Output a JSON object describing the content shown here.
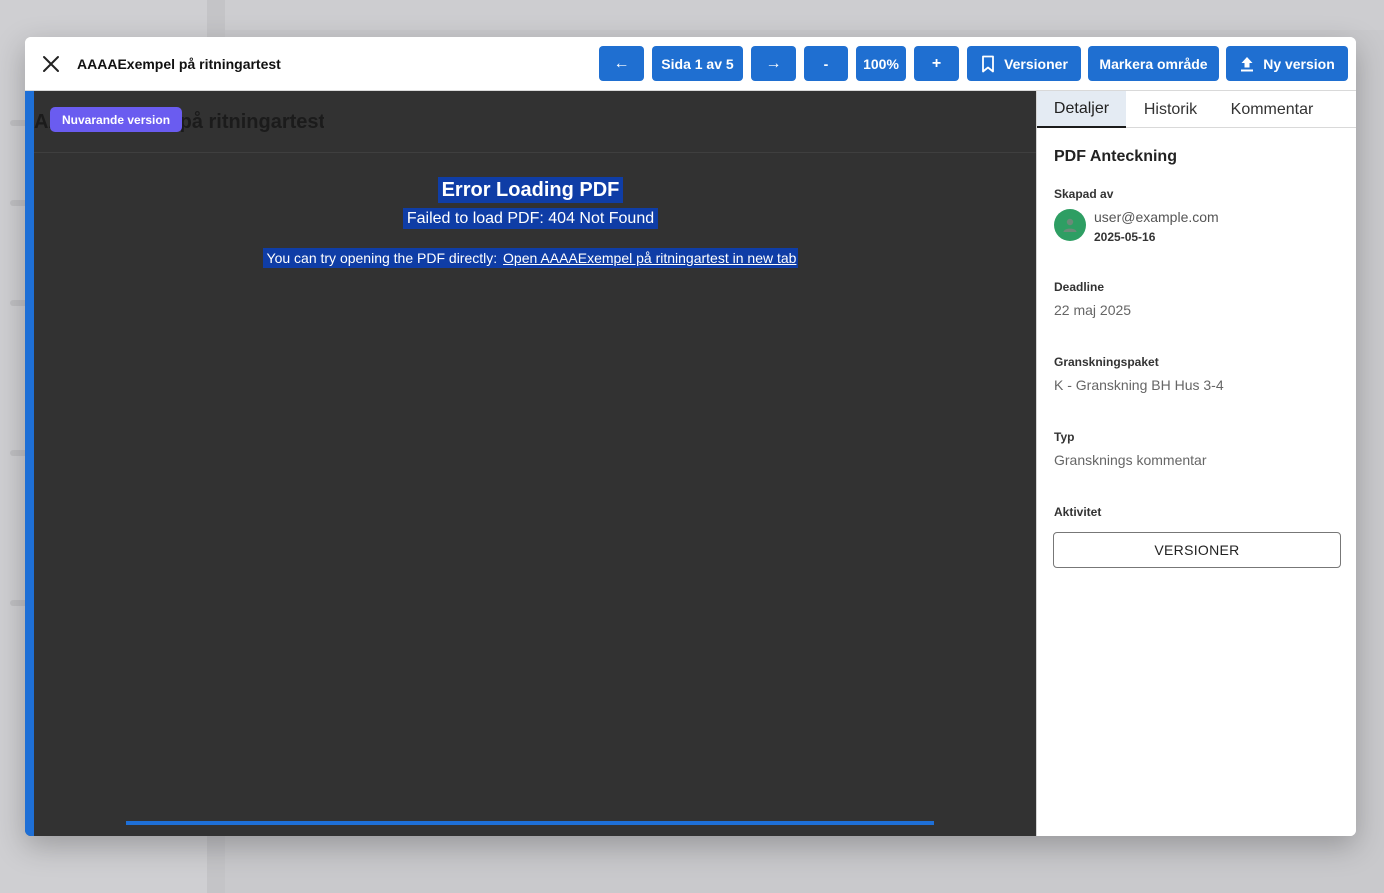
{
  "toolbar": {
    "title": "AAAAExempel på ritningartest",
    "prev_label": "←",
    "page_label": "Sida 1 av 5",
    "next_label": "→",
    "zoom_out_label": "-",
    "zoom_label": "100%",
    "zoom_in_label": "+",
    "versions_label": "Versioner",
    "mark_area_label": "Markera område",
    "new_version_label": "Ny version"
  },
  "viewer": {
    "badge": "Nuvarande version",
    "header_title": "AAAAExempel på ritningartest",
    "error_title": "Error Loading PDF",
    "error_message": "Failed to load PDF: 404 Not Found",
    "hint_text": "You can try opening the PDF directly:",
    "link_text": "Open AAAAExempel på ritningartest in new tab"
  },
  "panel": {
    "tabs": [
      {
        "label": "Detaljer",
        "active": true
      },
      {
        "label": "Historik",
        "active": false
      },
      {
        "label": "Kommentar",
        "active": false
      }
    ],
    "heading": "PDF Anteckning",
    "created_by_label": "Skapad av",
    "user_email": "user@example.com",
    "created_date": "2025-05-16",
    "deadline_label": "Deadline",
    "deadline_value": "22 maj 2025",
    "package_label": "Granskningspaket",
    "package_value": "K - Granskning BH Hus 3-4",
    "type_label": "Typ",
    "type_value": "Gransknings kommentar",
    "activity_label": "Aktivitet",
    "versions_button": "VERSIONER"
  },
  "colors": {
    "primary": "#1f6fd1",
    "badge": "#6a5cf0",
    "avatar": "#2e9e63",
    "viewer_bg": "#323232",
    "selection": "#0f3da6"
  }
}
